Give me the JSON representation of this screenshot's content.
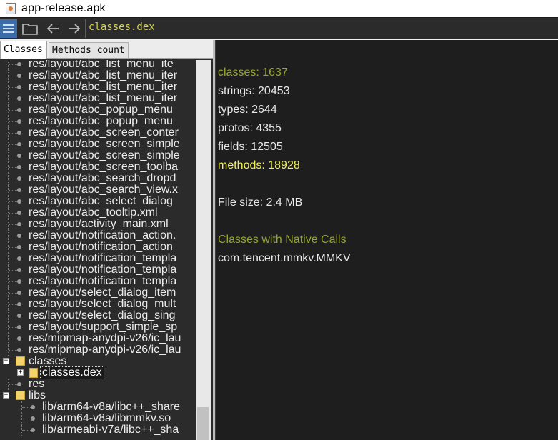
{
  "window": {
    "title": "app-release.apk"
  },
  "toolbar": {
    "path": "classes.dex"
  },
  "tabs": [
    {
      "label": "Classes"
    },
    {
      "label": "Methods count"
    }
  ],
  "tree": {
    "res_items": [
      "res/layout/abc_list_menu_ite",
      "res/layout/abc_list_menu_iter",
      "res/layout/abc_list_menu_iter",
      "res/layout/abc_list_menu_iter",
      "res/layout/abc_popup_menu",
      "res/layout/abc_popup_menu",
      "res/layout/abc_screen_conter",
      "res/layout/abc_screen_simple",
      "res/layout/abc_screen_simple",
      "res/layout/abc_screen_toolba",
      "res/layout/abc_search_dropd",
      "res/layout/abc_search_view.x",
      "res/layout/abc_select_dialog",
      "res/layout/abc_tooltip.xml",
      "res/layout/activity_main.xml",
      "res/layout/notification_action.",
      "res/layout/notification_action",
      "res/layout/notification_templa",
      "res/layout/notification_templa",
      "res/layout/notification_templa",
      "res/layout/select_dialog_item",
      "res/layout/select_dialog_mult",
      "res/layout/select_dialog_sing",
      "res/layout/support_simple_sp",
      "res/mipmap-anydpi-v26/ic_lau",
      "res/mipmap-anydpi-v26/ic_lau"
    ],
    "classes_folder": "classes",
    "classes_dex": "classes.dex",
    "res_folder": "res",
    "libs_folder": "libs",
    "lib_items": [
      "lib/arm64-v8a/libc++_share",
      "lib/arm64-v8a/libmmkv.so",
      "lib/armeabi-v7a/libc++_sha"
    ]
  },
  "stats": {
    "classes": "classes: 1637",
    "strings": "strings: 20453",
    "types": "types: 2644",
    "protos": "protos: 4355",
    "fields": "fields: 12505",
    "methods": "methods: 18928",
    "file_size": "File size: 2.4 MB",
    "native_header": "Classes with Native Calls",
    "native_class": "com.tencent.mmkv.MMKV"
  },
  "colors": {
    "toolbar_path": "#d6d64e",
    "olive": "#97a52b",
    "yellow": "#f0f05a",
    "panel_dark": "#1e1e1e"
  }
}
